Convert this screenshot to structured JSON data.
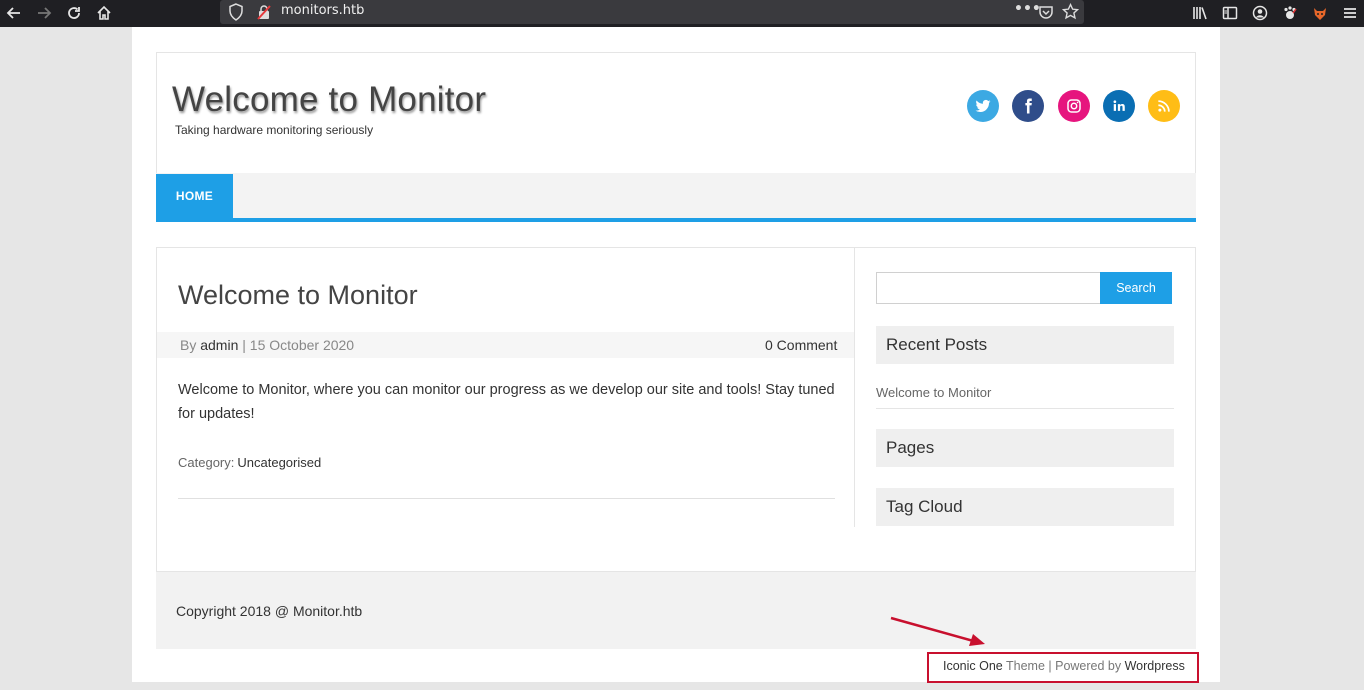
{
  "browser": {
    "url": "monitors.htb",
    "more_label": "•••"
  },
  "site": {
    "title": "Welcome to Monitor",
    "tagline": "Taking hardware monitoring seriously"
  },
  "social": [
    {
      "name": "twitter-icon",
      "color": "#3ca9e3"
    },
    {
      "name": "facebook-icon",
      "color": "#2f4d8a"
    },
    {
      "name": "instagram-icon",
      "color": "#e6157e"
    },
    {
      "name": "linkedin-icon",
      "color": "#0a6eb3"
    },
    {
      "name": "rss-icon",
      "color": "#ffbd16"
    }
  ],
  "nav": {
    "home_label": "HOME"
  },
  "post": {
    "title": "Welcome to Monitor",
    "by_label": "By",
    "author": "admin",
    "date_text": "| 15 October 2020",
    "comments": "0 Comment",
    "body": "Welcome to Monitor, where you can monitor our progress as we develop our site and tools! Stay tuned for updates!",
    "category_label": "Category:",
    "category": "Uncategorised"
  },
  "sidebar": {
    "search_button": "Search",
    "search_placeholder": "",
    "recent_posts_title": "Recent Posts",
    "recent_posts": [
      "Welcome to Monitor"
    ],
    "pages_title": "Pages",
    "tag_cloud_title": "Tag Cloud"
  },
  "footer": {
    "copyright": "Copyright 2018 @ Monitor.htb",
    "theme_name": "Iconic One",
    "theme_word": "Theme | Powered by",
    "powered_by": "Wordpress"
  },
  "colors": {
    "accent": "#1e9fe6",
    "annotation": "#c8102e"
  }
}
